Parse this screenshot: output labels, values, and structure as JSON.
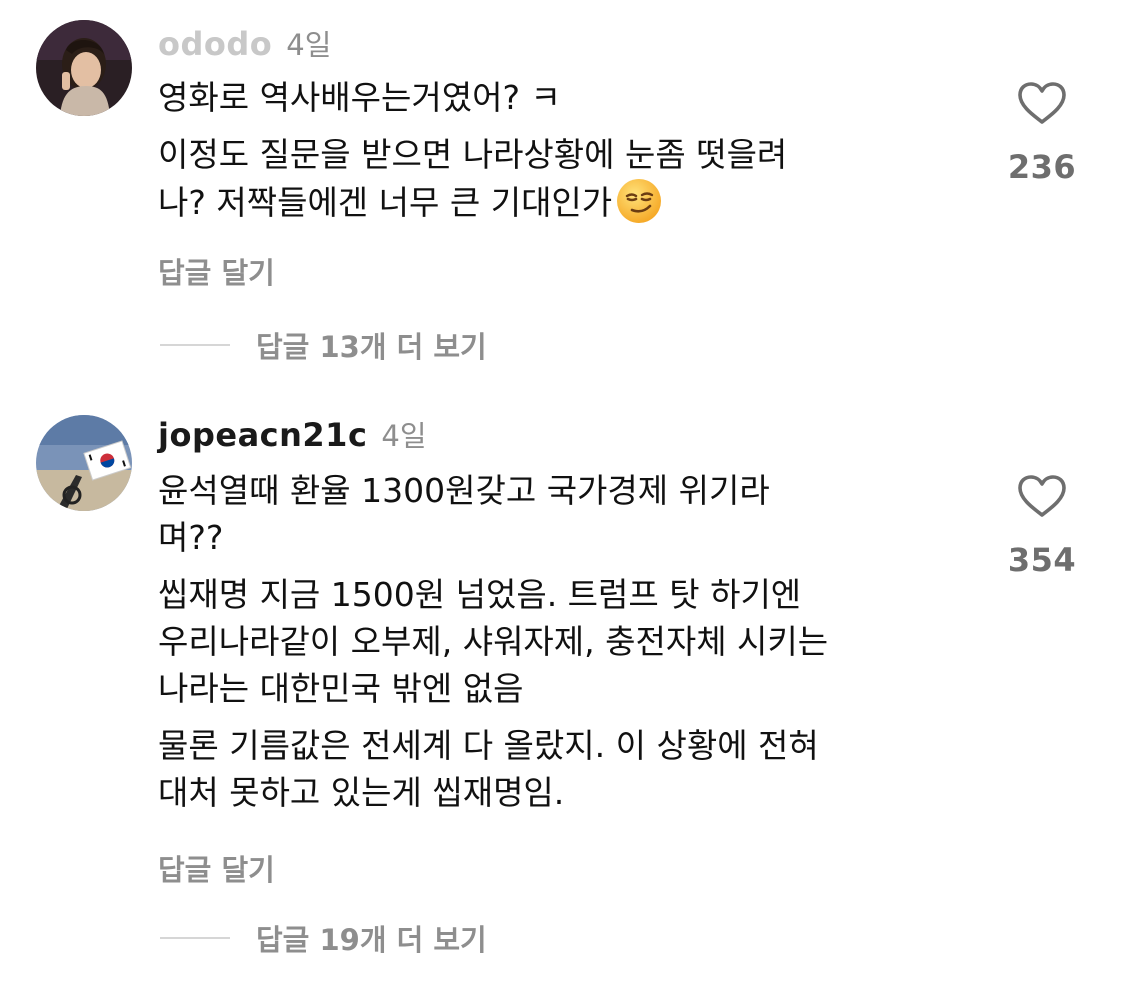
{
  "comments": [
    {
      "username": "ododo",
      "time": "4일",
      "paragraphs": [
        "영화로 역사배우는거였어? ㅋ",
        "이정도 질문을 받으면 나라상황에 눈좀 떳을려\n나? 저짝들에겐 너무 큰 기대인가"
      ],
      "emoji": "smirking-face-emoji",
      "likes": "236",
      "reply_label": "답글 달기",
      "more_replies_label": "답글 13개 더 보기"
    },
    {
      "username": "jopeacn21c",
      "time": "4일",
      "paragraphs": [
        "윤석열때 환율 1300원갖고 국가경제 위기라\n며??",
        "씹재명 지금 1500원 넘었음. 트럼프 탓 하기엔\n우리나라같이 오부제, 샤워자제, 충전자체 시키는\n나라는 대한민국 밖엔 없음",
        "물론 기름값은 전세계 다 올랐지. 이 상황에 전혀\n대처 못하고 있는게 씹재명임."
      ],
      "likes": "354",
      "reply_label": "답글 달기",
      "more_replies_label": "답글 19개 더 보기"
    }
  ],
  "icons": {
    "like": "heart-outline-icon",
    "colors": {
      "text": "#111111",
      "secondary": "#8e8e8e",
      "divider": "#d6d6d6",
      "heart_stroke": "#6e6e6e"
    }
  }
}
